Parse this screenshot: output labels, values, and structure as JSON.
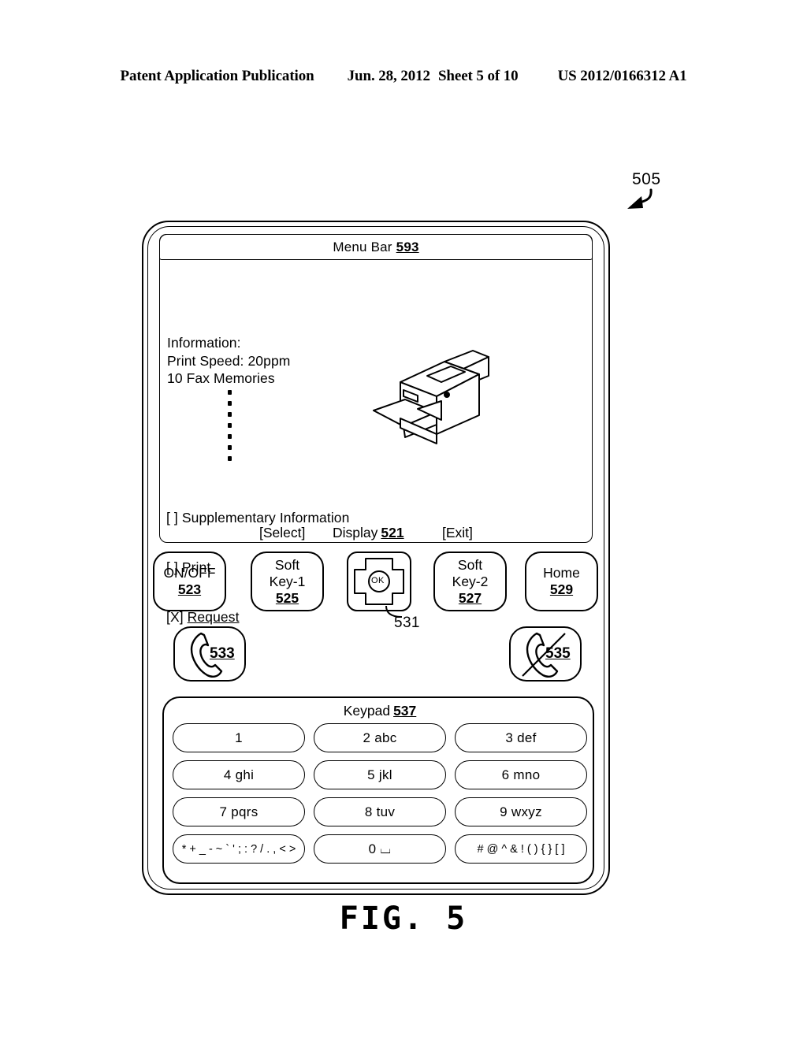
{
  "header": {
    "publication": "Patent Application Publication",
    "date": "Jun. 28, 2012",
    "sheet": "Sheet 5 of 10",
    "patent_number": "US 2012/0166312 A1"
  },
  "figure": {
    "caption": "FIG. 5",
    "device_reference": "505"
  },
  "device": {
    "display": {
      "menu_bar_label": "Menu Bar",
      "menu_bar_ref": "593",
      "information": {
        "heading": "Information:",
        "line1": "Print Speed: 20ppm",
        "line2": "10 Fax Memories",
        "ellipsis_dots": 7
      },
      "options": [
        {
          "marker": "[ ]",
          "label": "Supplementary Information",
          "selected": false
        },
        {
          "marker": "[ ]",
          "label": "Print",
          "selected": false
        },
        {
          "marker": "[X]",
          "label": "Request",
          "selected": true
        }
      ],
      "footer": {
        "select": "[Select]",
        "display_label": "Display",
        "display_ref": "521",
        "exit": "[Exit]"
      },
      "illustration": "printer-fax-icon"
    },
    "control_buttons": [
      {
        "label_line1": "ON/OFF",
        "label_line2": "",
        "ref": "523",
        "name": "on-off"
      },
      {
        "label_line1": "Soft",
        "label_line2": "Key-1",
        "ref": "525",
        "name": "soft-key-1"
      },
      {
        "label_line1": "Soft",
        "label_line2": "Key-2",
        "ref": "527",
        "name": "soft-key-2"
      },
      {
        "label_line1": "Home",
        "label_line2": "",
        "ref": "529",
        "name": "home"
      }
    ],
    "navigation_pad": {
      "ok_label": "OK",
      "ref": "531"
    },
    "phone_buttons": [
      {
        "icon": "handset-icon",
        "ref": "533",
        "name": "call-button"
      },
      {
        "icon": "handset-crossed-icon",
        "ref": "535",
        "name": "end-call-button"
      }
    ],
    "keypad": {
      "title": "Keypad",
      "ref": "537",
      "keys": [
        "1",
        "2 abc",
        "3 def",
        "4 ghi",
        "5 jkl",
        "6 mno",
        "7 pqrs",
        "8 tuv",
        "9 wxyz",
        "* + _ - ~ ` ' ; : ? / . , < >",
        "0 ⌴",
        "# @ ^ & ! ( ) { } [ ]"
      ]
    }
  },
  "colors": {
    "ink": "#000000",
    "paper": "#ffffff"
  }
}
